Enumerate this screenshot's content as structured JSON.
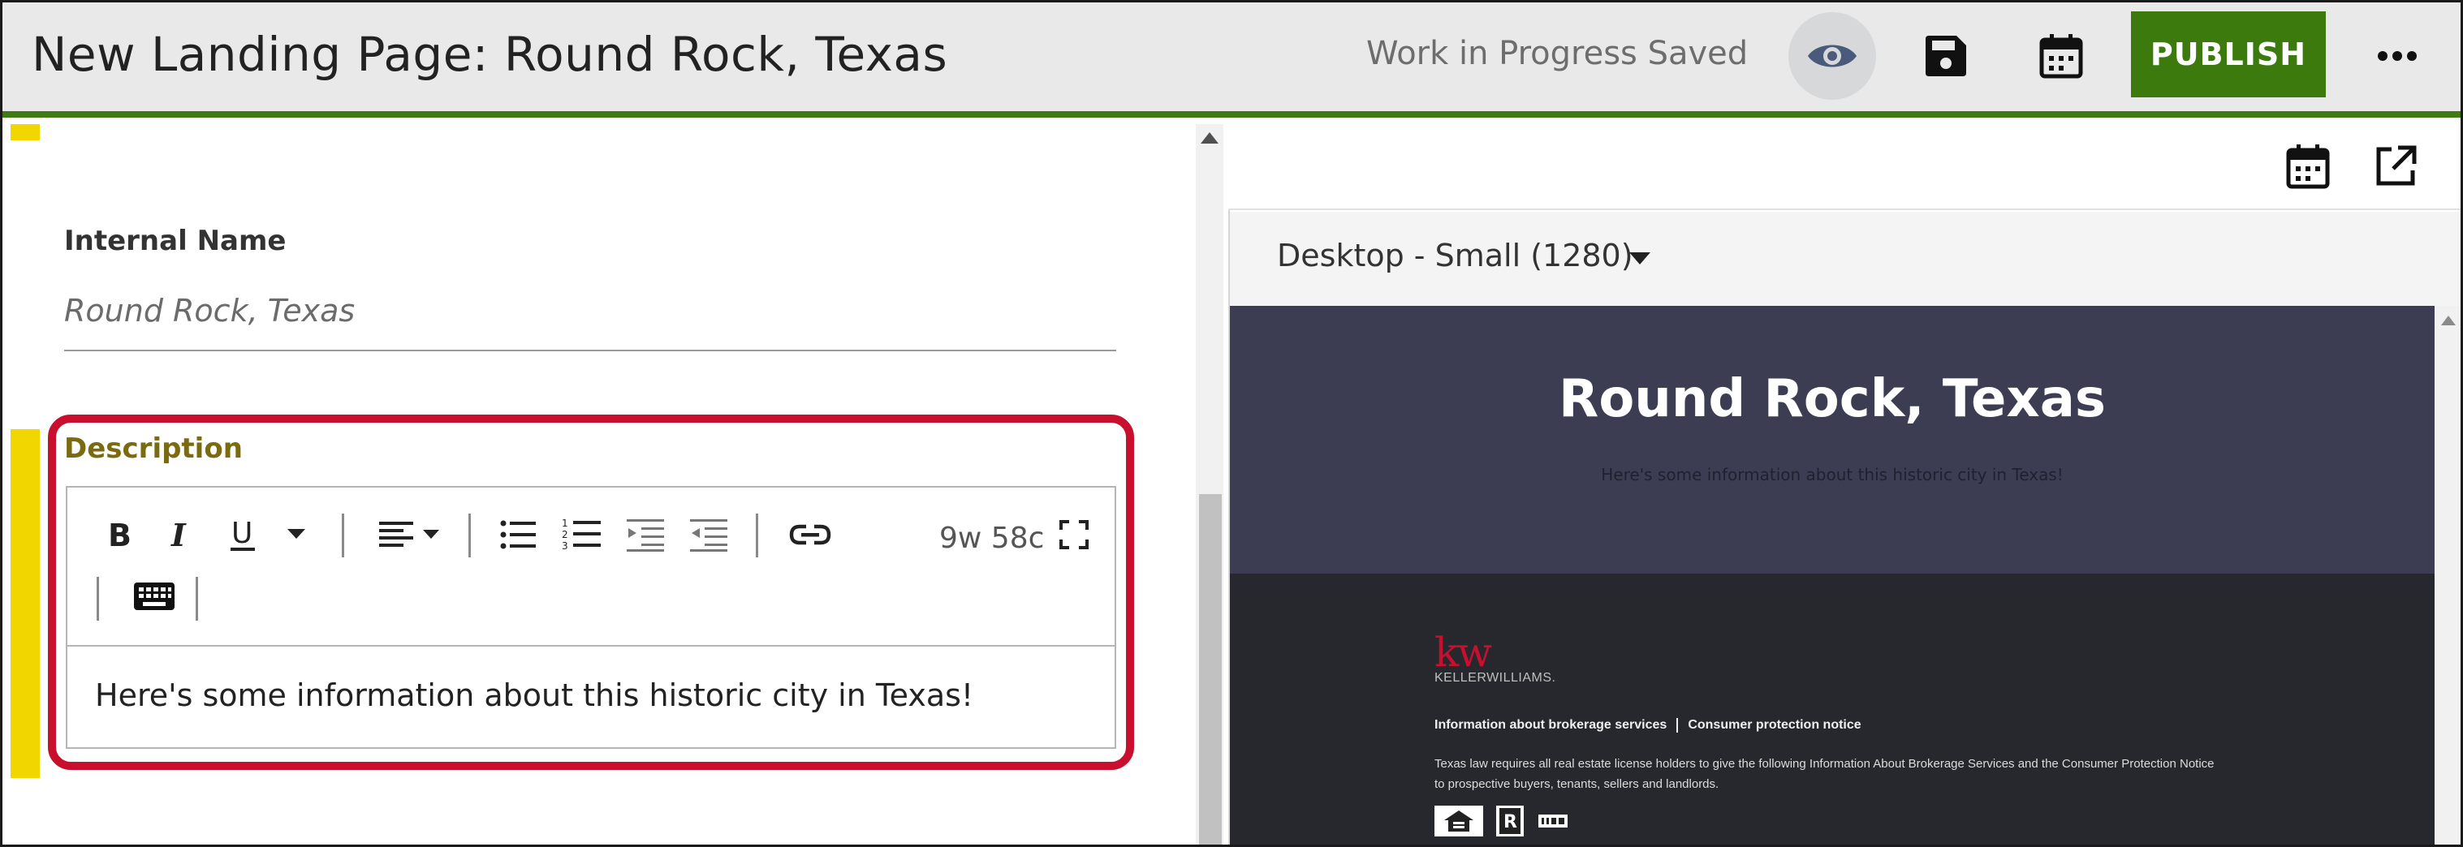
{
  "header": {
    "title": "New Landing Page: Round Rock, Texas",
    "status": "Work in Progress Saved",
    "publish_label": "PUBLISH",
    "icons": [
      "eye-icon",
      "save-icon",
      "calendar-icon",
      "more-icon"
    ],
    "accent_color": "#3d7a0e"
  },
  "form": {
    "internal_name": {
      "label": "Internal Name",
      "value": "Round Rock, Texas"
    },
    "description": {
      "label": "Description",
      "word_count": "9w 58c",
      "content": "Here's some information about this historic city in Texas!",
      "highlight_color": "#c8102e"
    }
  },
  "preview": {
    "device": "Desktop - Small (1280)",
    "hero_title": "Round Rock, Texas",
    "hero_subtitle": "Here's some information about this historic city in Texas!",
    "footer": {
      "logo": "kw",
      "brand": "KELLERWILLIAMS.",
      "link_brokerage": "Information about brokerage services",
      "link_consumer": "Consumer protection notice",
      "notice_line1": "Texas law requires all real estate license holders to give the following Information About Brokerage Services and the Consumer Protection Notice",
      "notice_line2": "to prospective buyers, tenants, sellers and landlords."
    }
  }
}
